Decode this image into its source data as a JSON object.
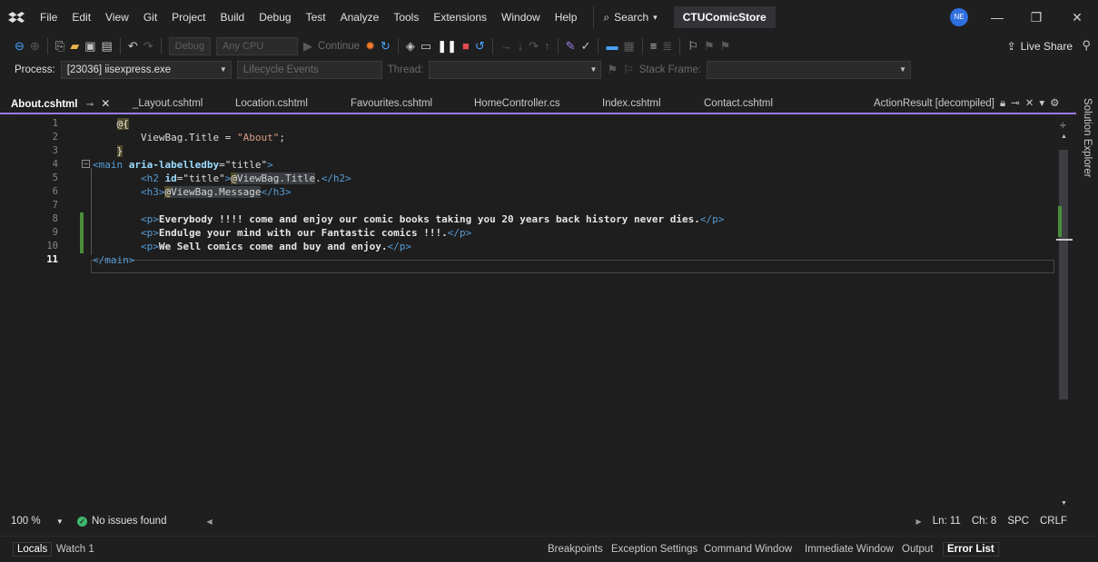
{
  "menubar": {
    "items": [
      "File",
      "Edit",
      "View",
      "Git",
      "Project",
      "Build",
      "Debug",
      "Test",
      "Analyze",
      "Tools",
      "Extensions",
      "Window",
      "Help"
    ],
    "search_label": "Search",
    "solution_name": "CTUComicStore",
    "avatar_initials": "NE"
  },
  "toolbar": {
    "config_combo": "Debug",
    "platform_combo": "Any CPU",
    "continue_label": "Continue",
    "live_share_label": "Live Share"
  },
  "debugbar": {
    "process_label": "Process:",
    "process_value": "[23036] iisexpress.exe",
    "lifecycle_label": "Lifecycle Events",
    "thread_label": "Thread:",
    "stack_frame_label": "Stack Frame:"
  },
  "tabs": {
    "items": [
      {
        "label": "About.cshtml",
        "active": true
      },
      {
        "label": "_Layout.cshtml"
      },
      {
        "label": "Location.cshtml"
      },
      {
        "label": "Favourites.cshtml"
      },
      {
        "label": "HomeController.cs"
      },
      {
        "label": "Index.cshtml"
      },
      {
        "label": "Contact.cshtml"
      }
    ],
    "right_tab": "ActionResult [decompiled]"
  },
  "side_panel": {
    "label": "Solution Explorer"
  },
  "editor": {
    "line_numbers": [
      "1",
      "2",
      "3",
      "4",
      "5",
      "6",
      "7",
      "8",
      "9",
      "10",
      "11"
    ],
    "lines": {
      "l1": "@{",
      "l2_ident": "ViewBag.Title = ",
      "l2_str": "\"About\"",
      "l2_end": ";",
      "l3": "}",
      "l4_open": "<main ",
      "l4_attr": "aria-labelledby",
      "l4_eq": "=",
      "l4_val": "\"title\"",
      "l4_close": ">",
      "l5_open": "<h2 ",
      "l5_attr": "id",
      "l5_eq": "=",
      "l5_val": "\"title\"",
      "l5_gt": ">",
      "l5_at": "@",
      "l5_expr": "ViewBag.Title",
      "l5_text": ".",
      "l5_end": "</h2>",
      "l6_open": "<h3>",
      "l6_at": "@",
      "l6_expr": "ViewBag.Message",
      "l6_end": "</h3>",
      "l8_open": "<p>",
      "l8_text": "Everybody !!!! come and enjoy our comic books taking you 20 years back history never dies.",
      "l8_end": "</p>",
      "l9_open": "<p>",
      "l9_text": "Endulge your mind with our Fantastic comics !!!.",
      "l9_end": "</p>",
      "l10_open": "<p>",
      "l10_text": "We Sell comics come and buy and enjoy.",
      "l10_end": "</p>",
      "l11": "</main>"
    }
  },
  "status": {
    "zoom": "100 %",
    "issues": "No issues found",
    "line": "Ln: 11",
    "column": "Ch: 8",
    "whitespace": "SPC",
    "line_ending": "CRLF"
  },
  "bottom_tabs": {
    "left": [
      "Locals",
      "Watch 1"
    ],
    "right": [
      "Breakpoints",
      "Exception Settings",
      "Command Window",
      "Immediate Window",
      "Output",
      "Error List"
    ]
  },
  "colors": {
    "accent": "#9a7ae8",
    "change_bar": "#4a8c3b",
    "avatar": "#2f6fdf",
    "success": "#3fb96f"
  }
}
